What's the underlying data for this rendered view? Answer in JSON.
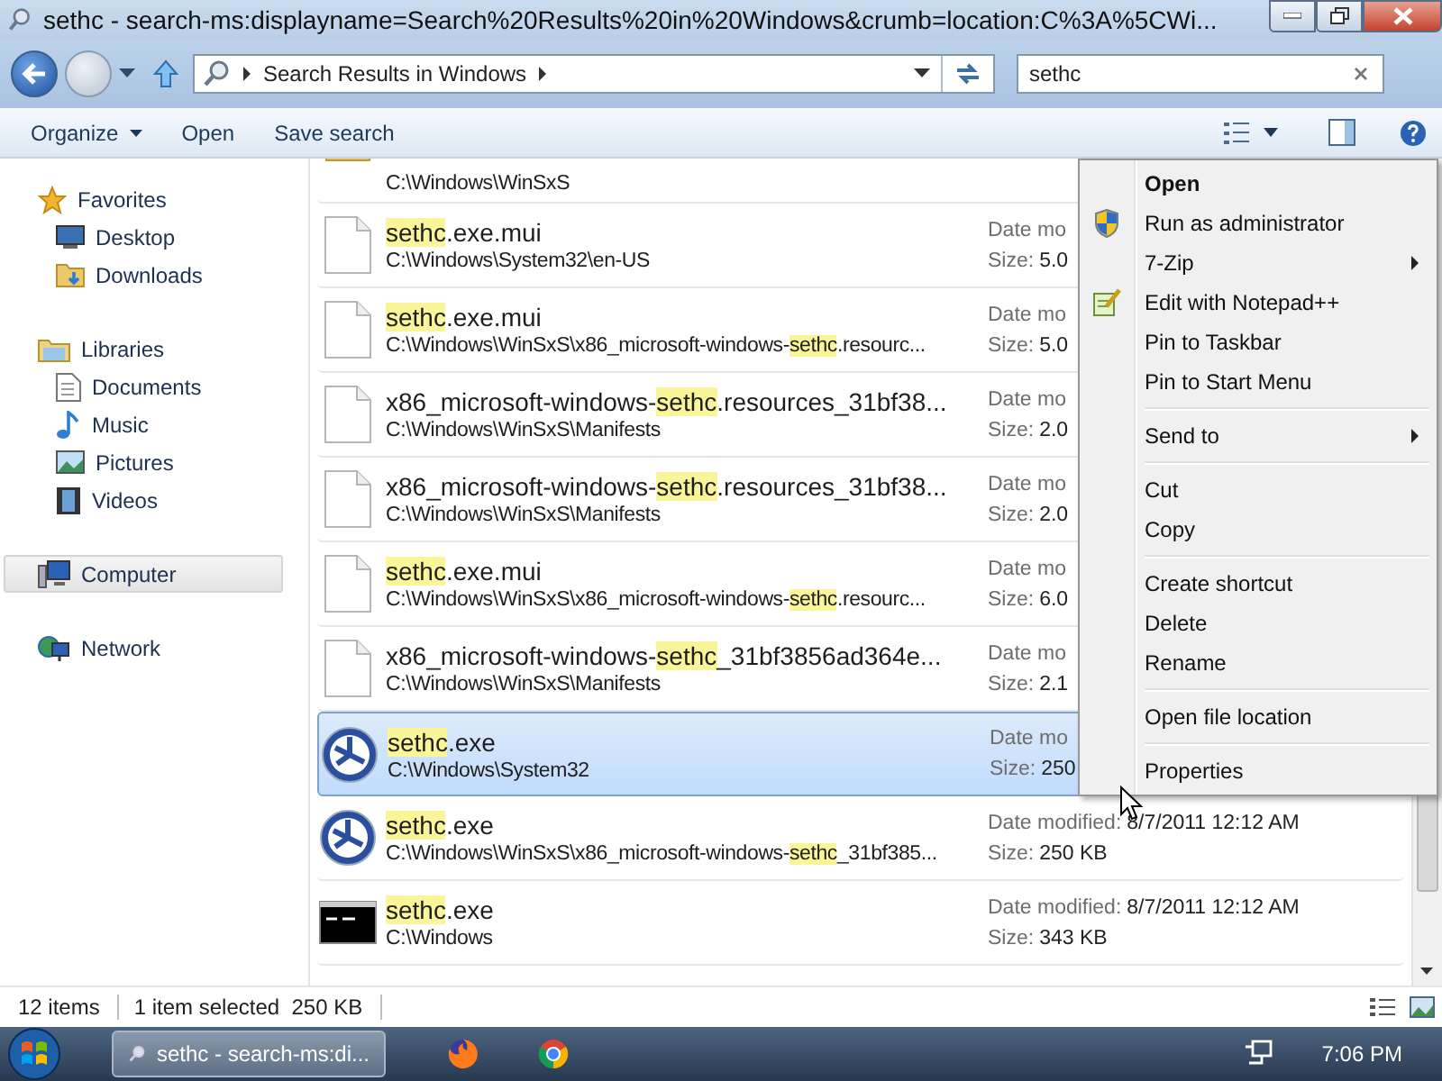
{
  "window": {
    "title": "sethc - search-ms:displayname=Search%20Results%20in%20Windows&crumb=location:C%3A%5CWi..."
  },
  "navigation": {
    "address": "Search Results in Windows",
    "search": {
      "value": "sethc"
    }
  },
  "toolbar": {
    "buttons": [
      {
        "label": "Organize",
        "dropdown": true
      },
      {
        "label": "Open",
        "dropdown": false
      },
      {
        "label": "Save search",
        "dropdown": false
      }
    ]
  },
  "sidebar": {
    "groups": [
      {
        "label": "Favorites",
        "kind": "favorites",
        "selected": false,
        "children": [
          {
            "label": "Desktop",
            "kind": "desktop",
            "selected": false
          },
          {
            "label": "Downloads",
            "kind": "downloads",
            "selected": false
          }
        ]
      },
      {
        "label": "Libraries",
        "kind": "libraries",
        "selected": false,
        "children": [
          {
            "label": "Documents",
            "kind": "documents",
            "selected": false
          },
          {
            "label": "Music",
            "kind": "music",
            "selected": false
          },
          {
            "label": "Pictures",
            "kind": "pictures",
            "selected": false
          },
          {
            "label": "Videos",
            "kind": "videos",
            "selected": false
          }
        ]
      },
      {
        "label": "Computer",
        "kind": "computer",
        "selected": true
      },
      {
        "label": "Network",
        "kind": "network",
        "selected": false
      }
    ]
  },
  "files": [
    {
      "kind": "folder",
      "selected": false,
      "path": [
        {
          "text": "C:\\Windows\\WinSxS",
          "match": false
        }
      ]
    },
    {
      "kind": "document",
      "selected": false,
      "name": [
        {
          "text": "sethc",
          "match": true
        },
        {
          "text": ".exe.mui",
          "match": false
        }
      ],
      "path": [
        {
          "text": "C:\\Windows\\System32\\en-US",
          "match": false
        }
      ],
      "date_label": "Date mo",
      "size_label": "Size:",
      "size_value": "5.0"
    },
    {
      "kind": "document",
      "selected": false,
      "name": [
        {
          "text": "sethc",
          "match": true
        },
        {
          "text": ".exe.mui",
          "match": false
        }
      ],
      "path": [
        {
          "text": "C:\\Windows\\WinSxS\\x86_microsoft-windows-",
          "match": false
        },
        {
          "text": "sethc",
          "match": true
        },
        {
          "text": ".resourc...",
          "match": false
        }
      ],
      "date_label": "Date mo",
      "size_label": "Size:",
      "size_value": "5.0"
    },
    {
      "kind": "document",
      "selected": false,
      "name": [
        {
          "text": "x86_microsoft-windows-",
          "match": false
        },
        {
          "text": "sethc",
          "match": true
        },
        {
          "text": ".resources_31bf38...",
          "match": false
        }
      ],
      "path": [
        {
          "text": "C:\\Windows\\WinSxS\\Manifests",
          "match": false
        }
      ],
      "date_label": "Date mo",
      "size_label": "Size:",
      "size_value": "2.0"
    },
    {
      "kind": "document",
      "selected": false,
      "name": [
        {
          "text": "x86_microsoft-windows-",
          "match": false
        },
        {
          "text": "sethc",
          "match": true
        },
        {
          "text": ".resources_31bf38...",
          "match": false
        }
      ],
      "path": [
        {
          "text": "C:\\Windows\\WinSxS\\Manifests",
          "match": false
        }
      ],
      "date_label": "Date mo",
      "size_label": "Size:",
      "size_value": "2.0"
    },
    {
      "kind": "document",
      "selected": false,
      "name": [
        {
          "text": "sethc",
          "match": true
        },
        {
          "text": ".exe.mui",
          "match": false
        }
      ],
      "path": [
        {
          "text": "C:\\Windows\\WinSxS\\x86_microsoft-windows-",
          "match": false
        },
        {
          "text": "sethc",
          "match": true
        },
        {
          "text": ".resourc...",
          "match": false
        }
      ],
      "date_label": "Date mo",
      "size_label": "Size:",
      "size_value": "6.0"
    },
    {
      "kind": "document",
      "selected": false,
      "name": [
        {
          "text": "x86_microsoft-windows-",
          "match": false
        },
        {
          "text": "sethc",
          "match": true
        },
        {
          "text": "_31bf3856ad364e...",
          "match": false
        }
      ],
      "path": [
        {
          "text": "C:\\Windows\\WinSxS\\Manifests",
          "match": false
        }
      ],
      "date_label": "Date mo",
      "size_label": "Size:",
      "size_value": "2.1"
    },
    {
      "kind": "app",
      "selected": true,
      "name": [
        {
          "text": "sethc",
          "match": true
        },
        {
          "text": ".exe",
          "match": false
        }
      ],
      "path": [
        {
          "text": "C:\\Windows\\System32",
          "match": false
        }
      ],
      "date_label": "Date mo",
      "size_label": "Size:",
      "size_value": "250"
    },
    {
      "kind": "app",
      "selected": false,
      "name": [
        {
          "text": "sethc",
          "match": true
        },
        {
          "text": ".exe",
          "match": false
        }
      ],
      "path": [
        {
          "text": "C:\\Windows\\WinSxS\\x86_microsoft-windows-",
          "match": false
        },
        {
          "text": "sethc",
          "match": true
        },
        {
          "text": "_31bf385...",
          "match": false
        }
      ],
      "date_label": "Date modified:",
      "date_value": "8/7/2011 12:12 AM",
      "size_label": "Size:",
      "size_value": "250 KB"
    },
    {
      "kind": "console",
      "selected": false,
      "name": [
        {
          "text": "sethc",
          "match": true
        },
        {
          "text": ".exe",
          "match": false
        }
      ],
      "path": [
        {
          "text": "C:\\Windows",
          "match": false
        }
      ],
      "date_label": "Date modified:",
      "date_value": "8/7/2011 12:12 AM",
      "size_label": "Size:",
      "size_value": "343 KB"
    }
  ],
  "context_menu": {
    "groups": [
      [
        {
          "label": "Open",
          "kind": "default",
          "submenu": false
        },
        {
          "label": "Run as administrator",
          "kind": "elevated",
          "submenu": false
        },
        {
          "label": "7-Zip",
          "kind": "plain",
          "submenu": true
        },
        {
          "label": "Edit with Notepad++",
          "kind": "editor",
          "submenu": false
        },
        {
          "label": "Pin to Taskbar",
          "kind": "plain",
          "submenu": false
        },
        {
          "label": "Pin to Start Menu",
          "kind": "plain",
          "submenu": false
        }
      ],
      [
        {
          "label": "Send to",
          "kind": "plain",
          "submenu": true
        }
      ],
      [
        {
          "label": "Cut",
          "kind": "plain",
          "submenu": false
        },
        {
          "label": "Copy",
          "kind": "plain",
          "submenu": false
        }
      ],
      [
        {
          "label": "Create shortcut",
          "kind": "plain",
          "submenu": false
        },
        {
          "label": "Delete",
          "kind": "plain",
          "submenu": false
        },
        {
          "label": "Rename",
          "kind": "plain",
          "submenu": false
        }
      ],
      [
        {
          "label": "Open file location",
          "kind": "plain",
          "submenu": false
        }
      ],
      [
        {
          "label": "Properties",
          "kind": "plain",
          "submenu": false
        }
      ]
    ]
  },
  "status_bar": {
    "count": "12 items",
    "selection": "1 item selected  250 KB"
  },
  "taskbar": {
    "tasks": [
      {
        "kind": "explorer",
        "label": "sethc - search-ms:di..."
      },
      {
        "kind": "firefox"
      },
      {
        "kind": "chrome"
      }
    ],
    "clock": "7:06 PM"
  }
}
